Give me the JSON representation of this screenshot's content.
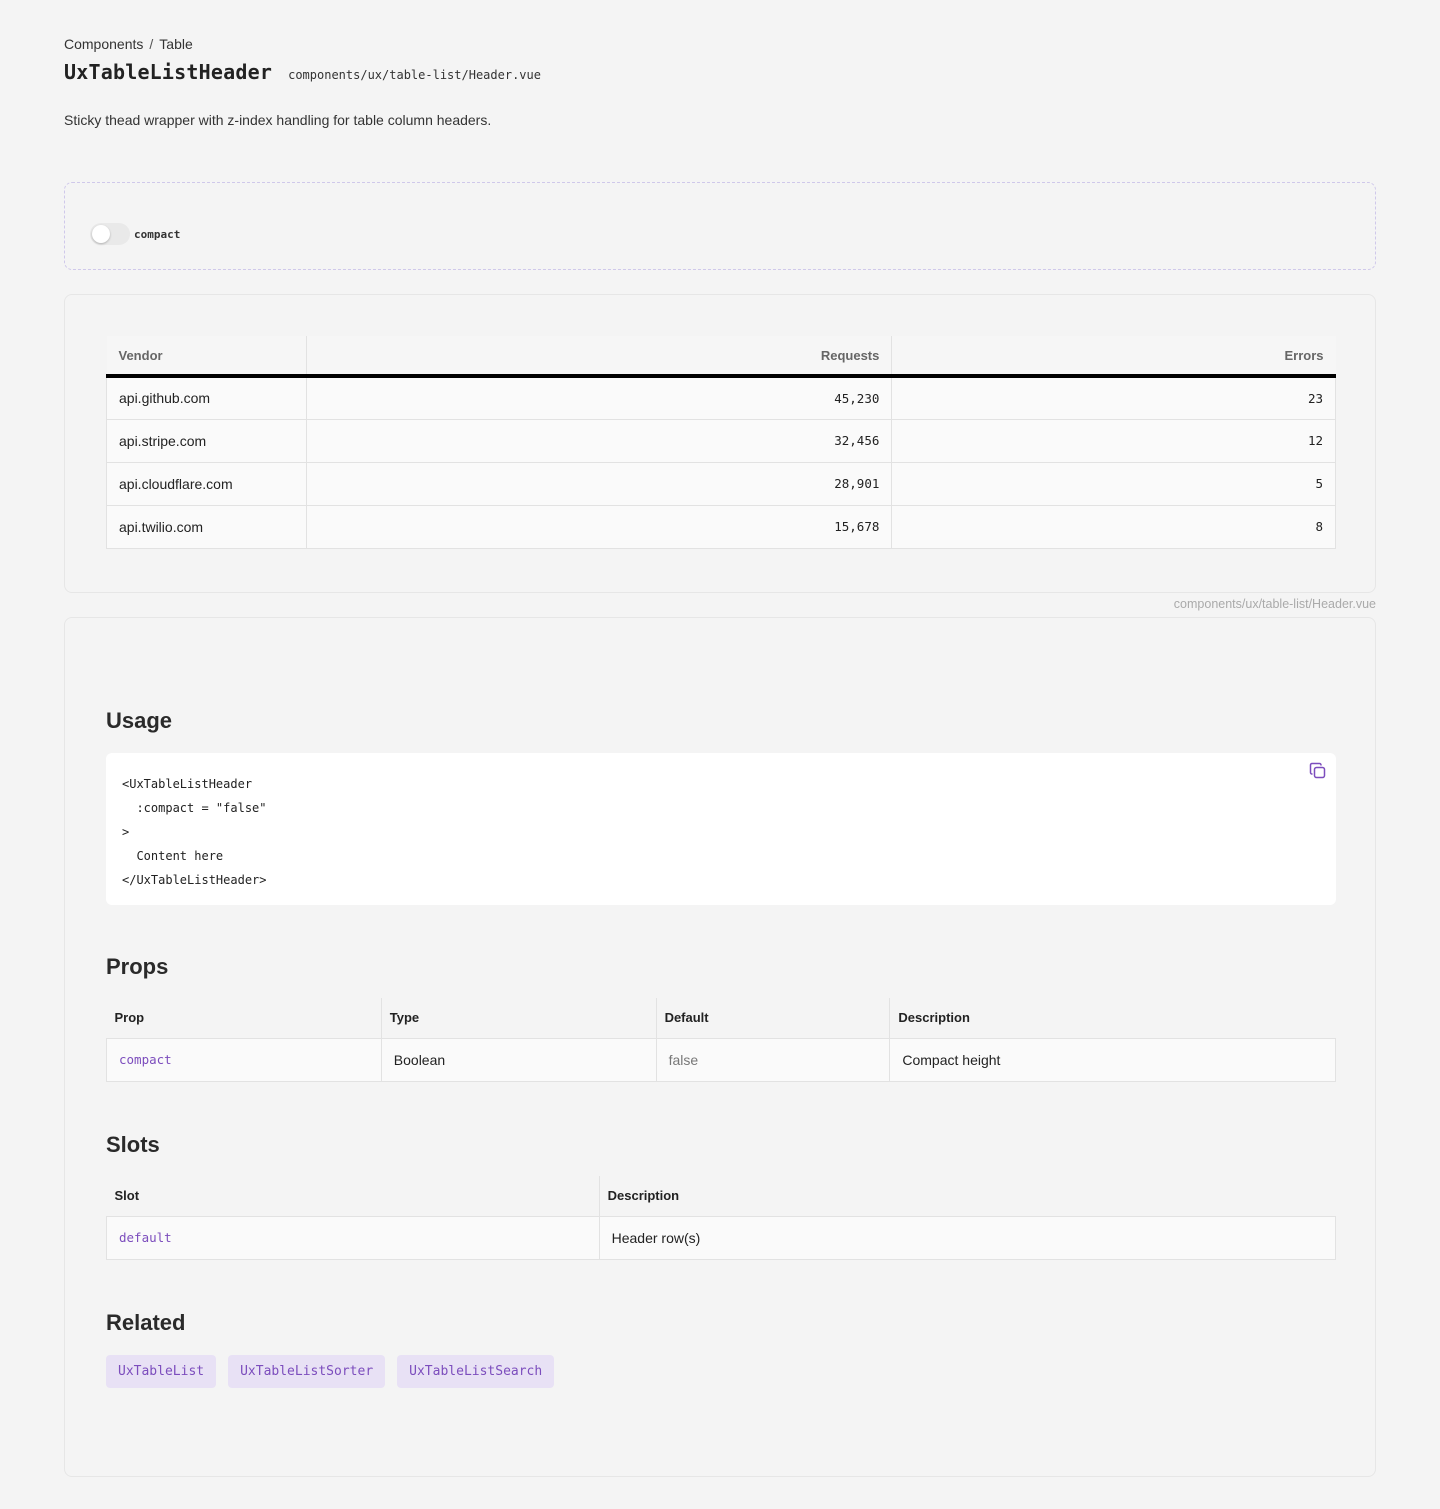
{
  "breadcrumb": {
    "items": [
      "Components",
      "Table"
    ],
    "separator": "/"
  },
  "header": {
    "title": "UxTableListHeader",
    "path": "components/ux/table-list/Header.vue",
    "description": "Sticky thead wrapper with z-index handling for table column headers."
  },
  "controls": {
    "toggles": [
      {
        "label": "compact",
        "checked": false
      }
    ]
  },
  "preview": {
    "columns": [
      "Vendor",
      "Requests",
      "Errors"
    ],
    "rows": [
      {
        "vendor": "api.github.com",
        "requests": "45,230",
        "errors": "23"
      },
      {
        "vendor": "api.stripe.com",
        "requests": "32,456",
        "errors": "12"
      },
      {
        "vendor": "api.cloudflare.com",
        "requests": "28,901",
        "errors": "5"
      },
      {
        "vendor": "api.twilio.com",
        "requests": "15,678",
        "errors": "8"
      }
    ],
    "source": "components/ux/table-list/Header.vue"
  },
  "usage": {
    "heading": "Usage",
    "lines": [
      "<UxTableListHeader",
      "  :compact = \"false\"",
      ">",
      "  Content here",
      "</UxTableListHeader>"
    ],
    "copy_icon": "copy-icon"
  },
  "props": {
    "heading": "Props",
    "columns": [
      "Prop",
      "Type",
      "Default",
      "Description"
    ],
    "rows": [
      {
        "prop": "compact",
        "type": "Boolean",
        "default": "false",
        "description": "Compact height"
      }
    ]
  },
  "slots": {
    "heading": "Slots",
    "columns": [
      "Slot",
      "Description"
    ],
    "rows": [
      {
        "slot": "default",
        "description": "Header row(s)"
      }
    ]
  },
  "related": {
    "heading": "Related",
    "items": [
      "UxTableList",
      "UxTableListSorter",
      "UxTableListSearch"
    ]
  },
  "colors": {
    "accent": "#7c4dbd",
    "chip_bg": "#e8e1f5",
    "page_bg": "#f4f4f4"
  }
}
